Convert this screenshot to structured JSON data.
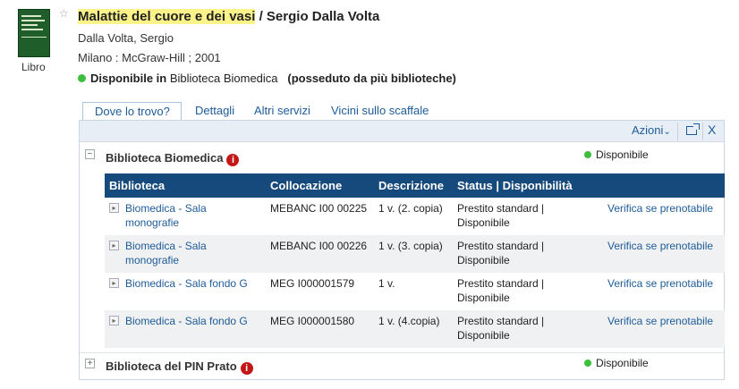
{
  "record": {
    "thumbnail_alt": "book-cover",
    "type_label": "Libro",
    "title_highlight": "Malattie del cuore e dei vasi",
    "title_rest": " / Sergio Dalla Volta",
    "author": "Dalla Volta, Sergio",
    "publication": "Milano : McGraw-Hill ; 2001",
    "availability_prefix": "Disponibile in",
    "availability_library": " Biblioteca Biomedica",
    "availability_note": "(posseduto da più biblioteche)"
  },
  "tabs": [
    {
      "label": "Dove lo trovo?",
      "active": true
    },
    {
      "label": "Dettagli",
      "active": false
    },
    {
      "label": "Altri servizi",
      "active": false
    },
    {
      "label": "Vicini sullo scaffale",
      "active": false
    }
  ],
  "toolbar": {
    "actions_label": "Azioni",
    "close_label": "X"
  },
  "libraries": [
    {
      "name": "Biblioteca Biomedica",
      "toggle": "−",
      "status": "Disponibile",
      "columns": [
        "Biblioteca",
        "Collocazione",
        "Descrizione",
        "Status | Disponibilità",
        ""
      ],
      "items": [
        {
          "library": "Biomedica - Sala monografie",
          "location": "MEBANC I00 00225",
          "description": "1 v. (2. copia)",
          "status": "Prestito standard | Disponibile",
          "action": "Verifica se prenotabile"
        },
        {
          "library": "Biomedica - Sala monografie",
          "location": "MEBANC I00 00226",
          "description": "1 v. (3. copia)",
          "status": "Prestito standard | Disponibile",
          "action": "Verifica se prenotabile"
        },
        {
          "library": "Biomedica - Sala fondo G",
          "location": "MEG I000001579",
          "description": "1 v.",
          "status": "Prestito standard | Disponibile",
          "action": "Verifica se prenotabile"
        },
        {
          "library": "Biomedica - Sala fondo G",
          "location": "MEG I000001580",
          "description": "1 v. (4.copia)",
          "status": "Prestito standard | Disponibile",
          "action": "Verifica se prenotabile"
        }
      ]
    },
    {
      "name": "Biblioteca del PIN Prato",
      "toggle": "+",
      "status": "Disponibile"
    }
  ],
  "colors": {
    "header_blue": "#174a7c",
    "link_blue": "#1f5b97",
    "available_green": "#3cbf3c",
    "highlight_yellow": "#fbf38a",
    "info_red": "#c41818"
  }
}
